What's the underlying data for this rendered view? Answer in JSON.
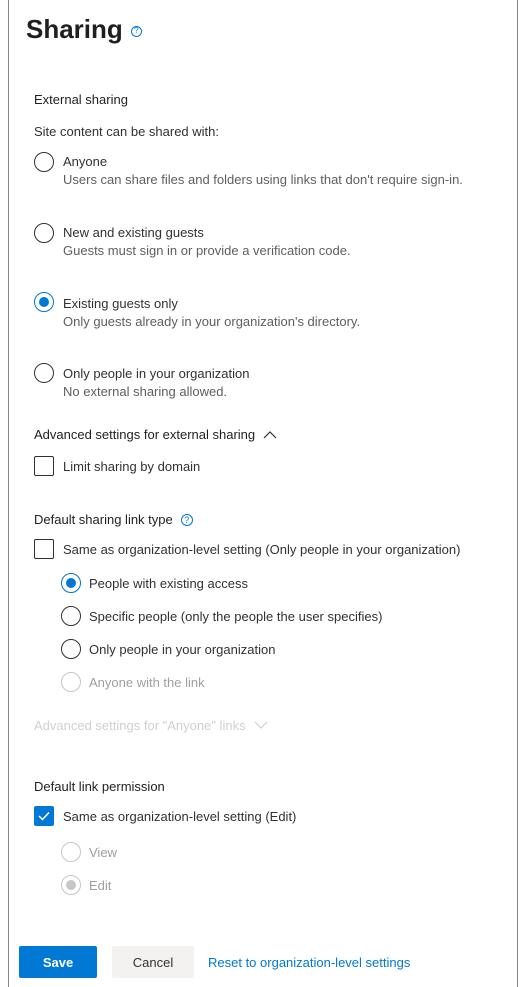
{
  "panel": {
    "title": "Sharing",
    "title_help_icon": "help-circle-icon"
  },
  "external_sharing": {
    "heading": "External sharing",
    "intro": "Site content can be shared with:",
    "options": [
      {
        "label": "Anyone",
        "description": "Users can share files and folders using links that don't require sign-in.",
        "checked": false
      },
      {
        "label": "New and existing guests",
        "description": "Guests must sign in or provide a verification code.",
        "checked": false
      },
      {
        "label": "Existing guests only",
        "description": "Only guests already in your organization's directory.",
        "checked": true
      },
      {
        "label": "Only people in your organization",
        "description": "No external sharing allowed.",
        "checked": false
      }
    ]
  },
  "advanced_external": {
    "label": "Advanced settings for external sharing",
    "chevron_icon": "chevron-up-icon",
    "limit_domain_label": "Limit sharing by domain",
    "limit_domain_checked": false
  },
  "default_link_type": {
    "heading": "Default sharing link type",
    "help_icon": "help-circle-icon",
    "same_as_org_label": "Same as organization-level setting (Only people in your organization)",
    "same_as_org_checked": false,
    "options": [
      {
        "label": "People with existing access",
        "checked": true,
        "disabled": false
      },
      {
        "label": "Specific people (only the people the user specifies)",
        "checked": false,
        "disabled": false
      },
      {
        "label": "Only people in your organization",
        "checked": false,
        "disabled": false
      },
      {
        "label": "Anyone with the link",
        "checked": false,
        "disabled": true
      }
    ],
    "anyone_advanced_label": "Advanced settings for \"Anyone\" links",
    "anyone_advanced_chevron": "chevron-down-icon"
  },
  "default_link_permission": {
    "heading": "Default link permission",
    "same_as_org_label": "Same as organization-level setting (Edit)",
    "same_as_org_checked": true,
    "options": [
      {
        "label": "View",
        "checked": false,
        "disabled": true
      },
      {
        "label": "Edit",
        "checked": true,
        "disabled": true
      }
    ]
  },
  "footer": {
    "save_label": "Save",
    "cancel_label": "Cancel",
    "reset_label": "Reset to organization-level settings"
  },
  "colors": {
    "accent": "#0078d4",
    "text": "#323130",
    "disabled": "#a19f9d"
  }
}
